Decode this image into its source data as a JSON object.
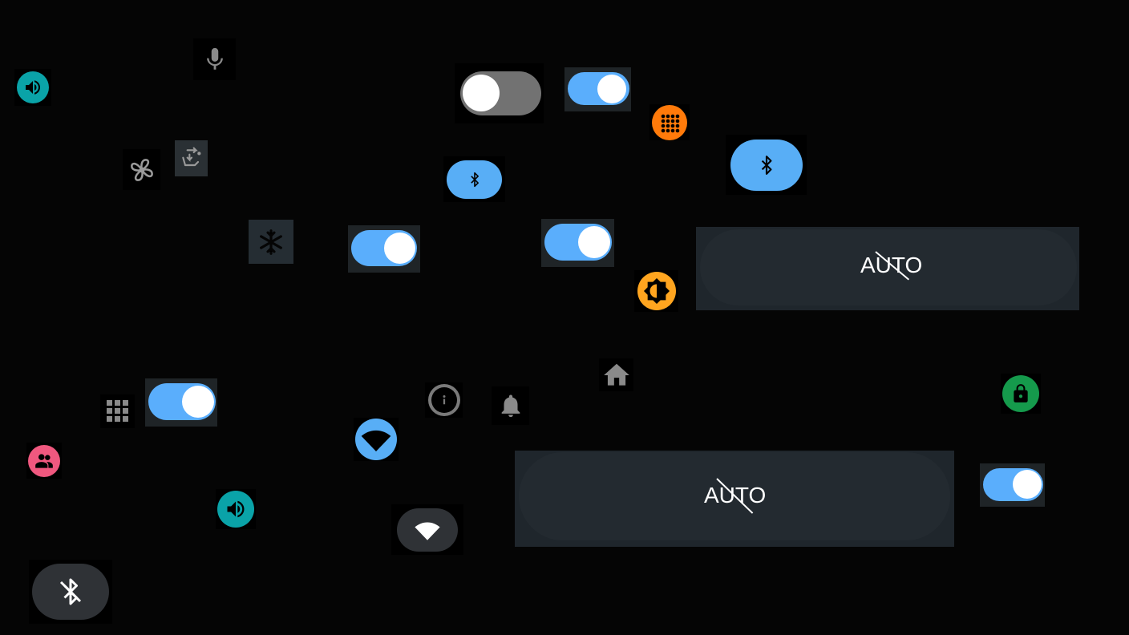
{
  "colors": {
    "background": "#050505",
    "toggle_on_track": "#5aaefc",
    "toggle_off_track": "#727272",
    "teal": "#0aa3a8",
    "orange": "#ff7a0a",
    "amber": "#ffa51f",
    "pink": "#f0587f",
    "green": "#159a4c",
    "bluetooth_on": "#58aef6",
    "bluetooth_off": "#2f3236",
    "icon_gray": "#8a8a8a"
  },
  "icons": [
    "volume-icon",
    "microphone-icon",
    "fan-icon",
    "seat-recline-icon",
    "snowflake-icon",
    "grid-icon",
    "apps-dots-icon",
    "bluetooth-icon",
    "brightness-icon",
    "info-icon",
    "bell-icon",
    "home-icon",
    "lock-icon",
    "people-icon",
    "wifi-icon",
    "bluetooth-off-icon"
  ],
  "toggles": [
    {
      "id": "toggle-1",
      "state": "off"
    },
    {
      "id": "toggle-2",
      "state": "on"
    },
    {
      "id": "toggle-3",
      "state": "on"
    },
    {
      "id": "toggle-4",
      "state": "on"
    },
    {
      "id": "toggle-5",
      "state": "on"
    },
    {
      "id": "toggle-6",
      "state": "on"
    }
  ],
  "auto_buttons": [
    {
      "label": "AUTO",
      "state": "disabled"
    },
    {
      "label": "AUTO",
      "state": "disabled"
    }
  ]
}
